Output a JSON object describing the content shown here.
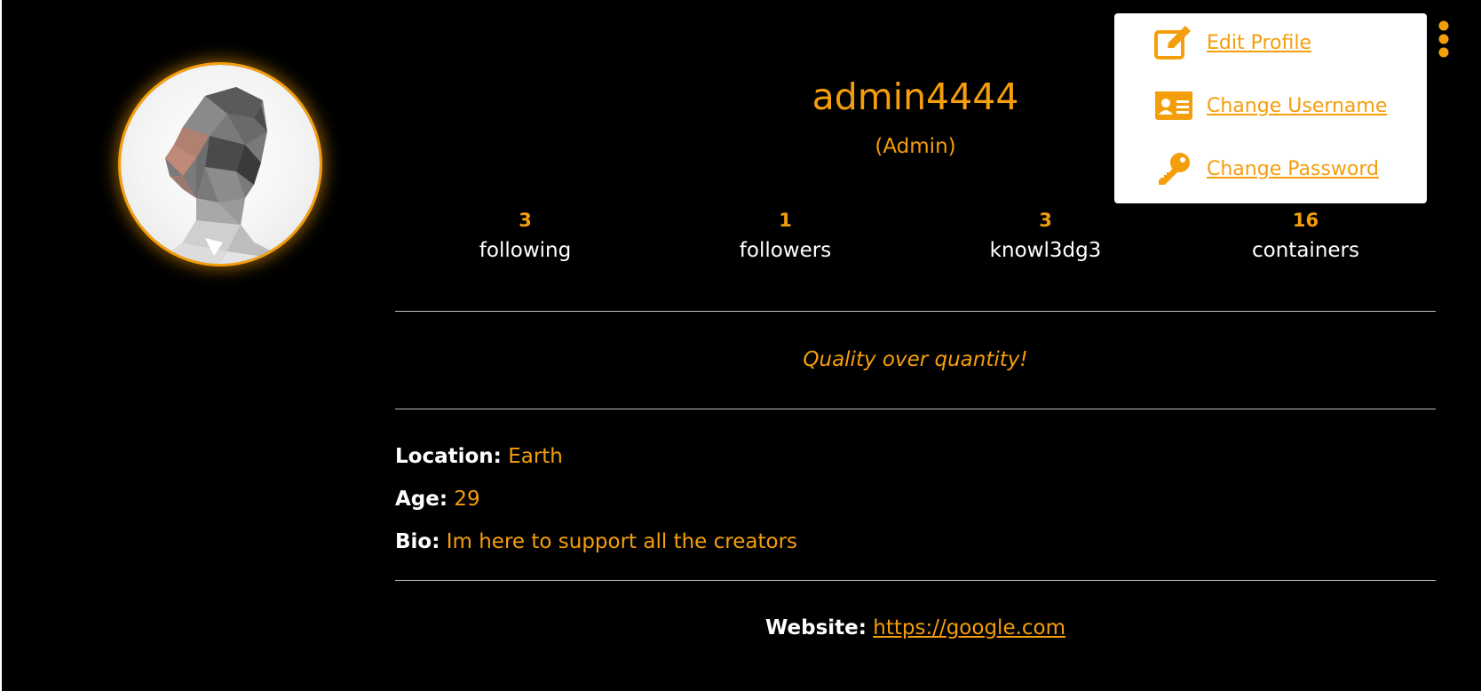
{
  "profile": {
    "username": "admin4444",
    "role": "(Admin)",
    "tagline": "Quality over quantity!"
  },
  "stats": [
    {
      "value": "3",
      "label": "following"
    },
    {
      "value": "1",
      "label": "followers"
    },
    {
      "value": "3",
      "label": "knowl3dg3"
    },
    {
      "value": "16",
      "label": "containers"
    }
  ],
  "details": {
    "location_label": "Location:",
    "location_value": "Earth",
    "age_label": "Age:",
    "age_value": "29",
    "bio_label": "Bio:",
    "bio_value": "Im here to support all the creators"
  },
  "website": {
    "label": "Website:",
    "url": "https://google.com"
  },
  "menu": {
    "items": [
      {
        "label": "Edit Profile",
        "icon": "edit-icon"
      },
      {
        "label": "Change Username",
        "icon": "id-card-icon"
      },
      {
        "label": "Change Password",
        "icon": "key-icon"
      }
    ]
  },
  "colors": {
    "accent": "#f59e0b",
    "background": "#000000",
    "text": "#ffffff",
    "menu_background": "#ffffff"
  }
}
